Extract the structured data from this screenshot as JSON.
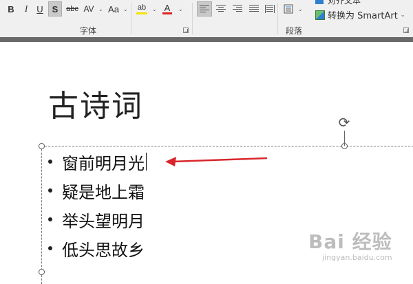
{
  "ribbon": {
    "font_group_label": "字体",
    "paragraph_group_label": "段落",
    "bold_label": "B",
    "italic_label": "I",
    "underline_label": "U",
    "shadow_label": "S",
    "strike_label": "abc",
    "spacing_label": "AV",
    "case_label": "Aa",
    "highlight_label": "ab",
    "font_color_label": "A",
    "highlight_color": "#f5e400",
    "font_color": "#e02020",
    "convert_smartart_label": "转换为 SmartArt",
    "align_text_label_partial": "对齐文本"
  },
  "slide": {
    "title": "古诗词",
    "bullets": [
      "窗前明月光",
      "疑是地上霜",
      "举头望明月",
      "低头思故乡"
    ],
    "arrow_color": "#d8262c"
  },
  "watermark": {
    "brand": "Bai 经验",
    "url": "jingyan.baidu.com"
  }
}
